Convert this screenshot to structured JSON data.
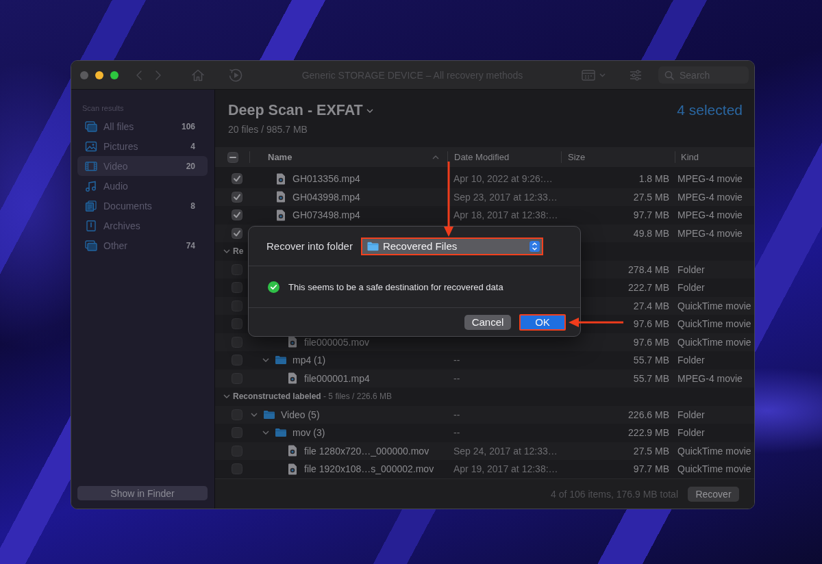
{
  "window": {
    "title": "Generic STORAGE DEVICE – All recovery methods"
  },
  "toolbar": {
    "search_placeholder": "Search"
  },
  "sidebar": {
    "heading": "Scan results",
    "items": [
      {
        "kind": "all",
        "label": "All files",
        "count": "106",
        "selected": false
      },
      {
        "kind": "pictures",
        "label": "Pictures",
        "count": "4",
        "selected": false
      },
      {
        "kind": "video",
        "label": "Video",
        "count": "20",
        "selected": true
      },
      {
        "kind": "audio",
        "label": "Audio",
        "selected": false
      },
      {
        "kind": "documents",
        "label": "Documents",
        "count": "8",
        "selected": false
      },
      {
        "kind": "archives",
        "label": "Archives",
        "selected": false
      },
      {
        "kind": "other",
        "label": "Other",
        "count": "74",
        "selected": false
      }
    ],
    "button": "Show in Finder"
  },
  "header": {
    "title": "Deep Scan - EXFAT",
    "subtitle": "20 files / 985.7 MB",
    "selection": "4 selected"
  },
  "table": {
    "select_all": {
      "indeterminate": true
    },
    "columns": [
      {
        "label": "Name",
        "sorted": true
      },
      {
        "label": "Date Modified",
        "sorted": false
      },
      {
        "label": "Size",
        "sorted": false
      },
      {
        "label": "Kind",
        "sorted": false
      }
    ],
    "sections": [
      {
        "rows": [
          {
            "children": [
              {
                "kind": "file",
                "name": "GH013356.mp4",
                "date": "Apr 10, 2022 at 9:26:…",
                "size": "1.8 MB",
                "type": "MPEG-4 movie",
                "checked": true
              },
              {
                "kind": "file",
                "name": "GH043998.mp4",
                "date": "Sep 23, 2017 at 12:33…",
                "size": "27.5 MB",
                "type": "MPEG-4 movie",
                "checked": true
              },
              {
                "kind": "file",
                "name": "GH073498.mp4",
                "date": "Apr 18, 2017 at 12:38:…",
                "size": "97.7 MB",
                "type": "MPEG-4 movie",
                "checked": true
              },
              {
                "kind": "file",
                "size": "49.8 MB",
                "type": "MPEG-4 movie",
                "checked": true
              }
            ]
          }
        ]
      },
      {
        "label": "Re",
        "expanded": true,
        "rows": [
          {
            "kind": "folder",
            "size": "278.4 MB",
            "type": "Folder",
            "checked": false,
            "children": [
              {
                "kind": "folder",
                "size": "222.7 MB",
                "type": "Folder",
                "checked": false,
                "children": [
                  {
                    "kind": "file",
                    "size": "27.4 MB",
                    "type": "QuickTime movie",
                    "checked": false
                  },
                  {
                    "kind": "file",
                    "size": "97.6 MB",
                    "type": "QuickTime movie",
                    "checked": false
                  },
                  {
                    "kind": "file",
                    "name": "file000005.mov",
                    "size": "97.6 MB",
                    "type": "QuickTime movie",
                    "checked": false
                  }
                ]
              },
              {
                "kind": "folder",
                "name": "mp4 (1)",
                "expanded": true,
                "date": "--",
                "size": "55.7 MB",
                "type": "Folder",
                "checked": false,
                "children": [
                  {
                    "kind": "file",
                    "name": "file000001.mp4",
                    "date": "--",
                    "size": "55.7 MB",
                    "type": "MPEG-4 movie",
                    "checked": false
                  }
                ]
              }
            ]
          }
        ]
      },
      {
        "label": "Reconstructed labeled",
        "summary": "- 5 files / 226.6 MB",
        "expanded": true,
        "rows": [
          {
            "kind": "folder",
            "name": "Video (5)",
            "expanded": true,
            "date": "--",
            "size": "226.6 MB",
            "type": "Folder",
            "checked": false,
            "children": [
              {
                "kind": "folder",
                "name": "mov (3)",
                "expanded": true,
                "date": "--",
                "size": "222.9 MB",
                "type": "Folder",
                "checked": false,
                "children": [
                  {
                    "kind": "file",
                    "name": "file 1280x720…_000000.mov",
                    "date": "Sep 24, 2017 at 12:33…",
                    "size": "27.5 MB",
                    "type": "QuickTime movie",
                    "checked": false
                  },
                  {
                    "kind": "file",
                    "name": "file 1920x108…s_000002.mov",
                    "date": "Apr 19, 2017 at 12:38:…",
                    "size": "97.7 MB",
                    "type": "QuickTime movie",
                    "checked": false
                  }
                ]
              }
            ]
          }
        ]
      }
    ]
  },
  "footer": {
    "summary": "4 of 106 items, 176.9 MB total",
    "button": "Recover"
  },
  "dialog": {
    "label": "Recover into folder",
    "folder": {
      "name": "Recovered Files",
      "highlighted": true
    },
    "message": "This seems to be a safe destination for recovered data",
    "buttons": [
      {
        "label": "Cancel",
        "primary": false,
        "highlighted": false
      },
      {
        "label": "OK",
        "primary": true,
        "highlighted": true
      }
    ]
  }
}
